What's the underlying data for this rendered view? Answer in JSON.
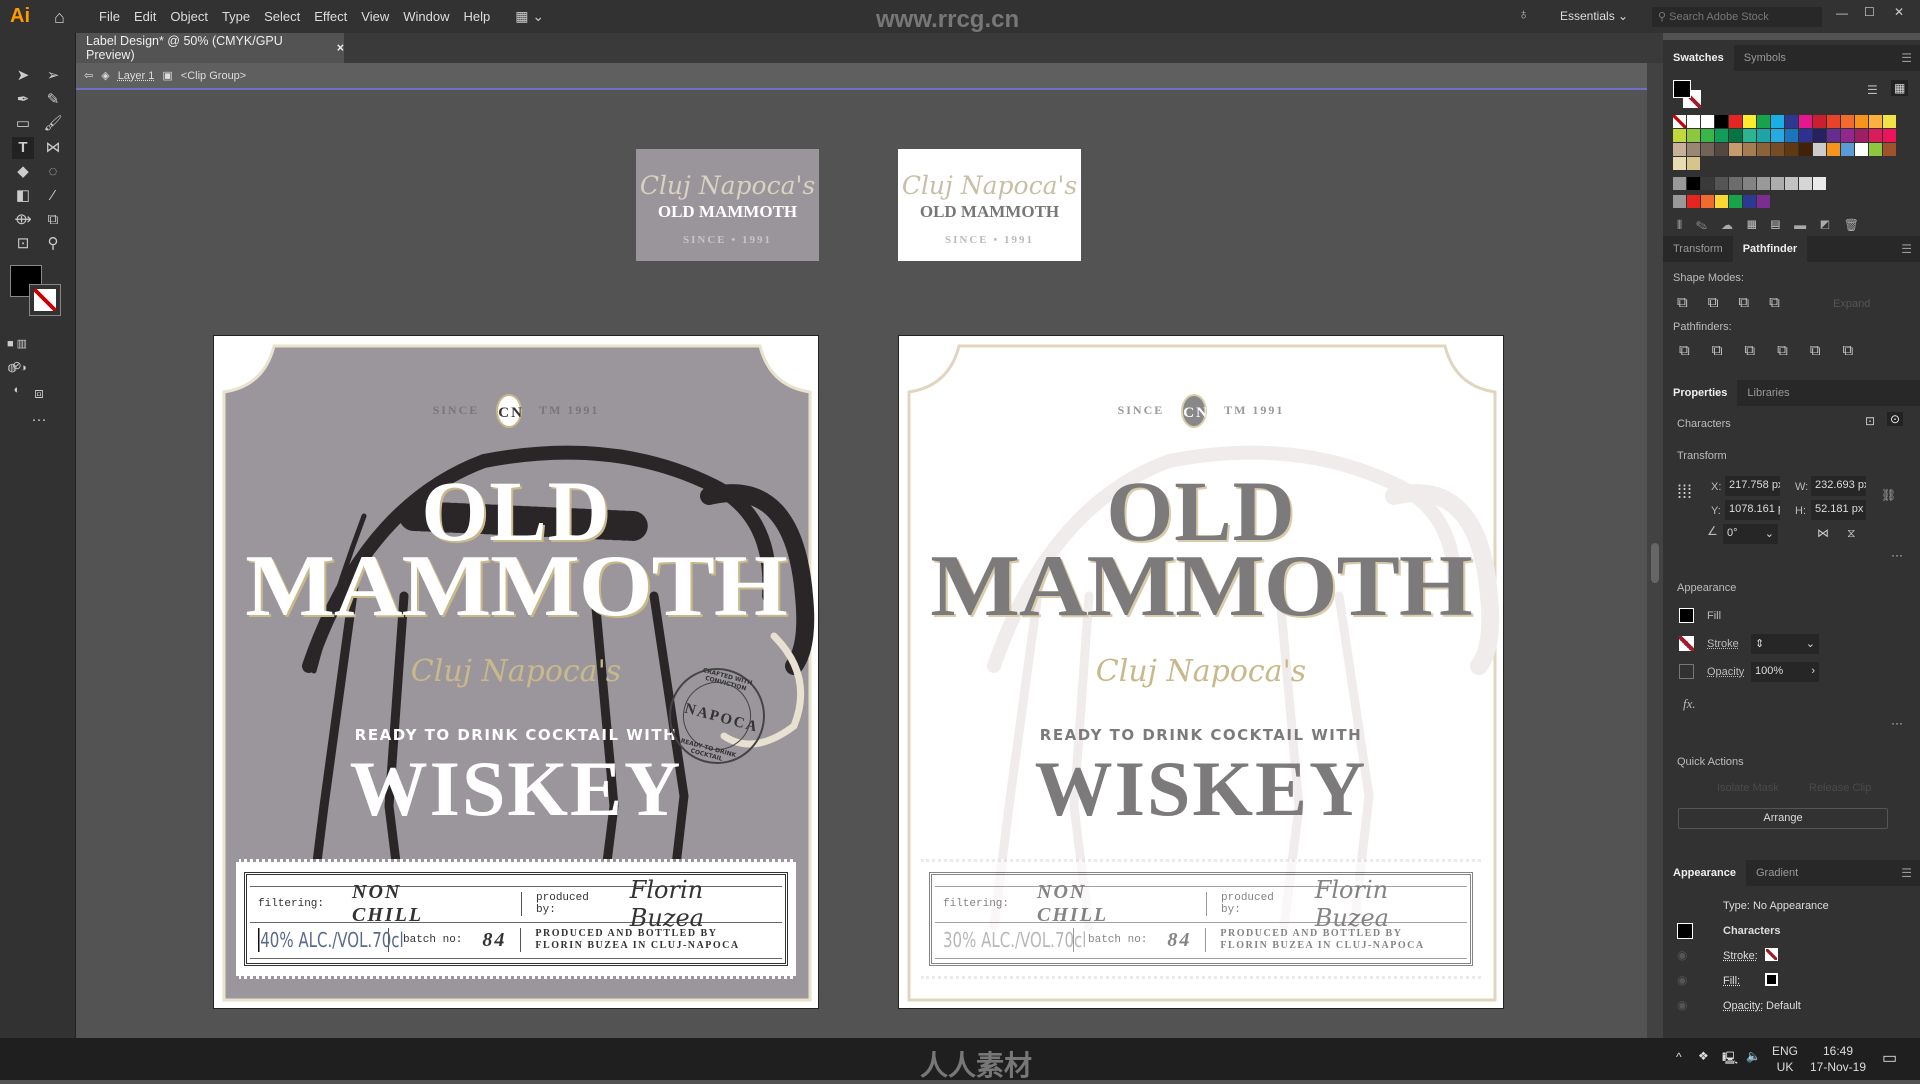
{
  "app": {
    "logo": "Ai",
    "menu": [
      "File",
      "Edit",
      "Object",
      "Type",
      "Select",
      "Effect",
      "View",
      "Window",
      "Help"
    ],
    "workspace": "Essentials",
    "search_placeholder": "Search Adobe Stock",
    "watermark": "www.rrcg.cn"
  },
  "document": {
    "tab_title": "Label Design* @ 50% (CMYK/GPU Preview)",
    "close": "×",
    "breadcrumb": {
      "layer": "Layer 1",
      "group": "<Clip Group>"
    }
  },
  "colors": {
    "accent": "#ff9a00",
    "label_grey": "#9b969c",
    "gold": "#c9b98a",
    "selection": "#6a72c8"
  },
  "artboards": {
    "small_labels": [
      {
        "variant": "grey",
        "script": "Cluj Napoca's",
        "name": "OLD MAMMOTH",
        "since": "SINCE • 1991"
      },
      {
        "variant": "white",
        "script": "Cluj Napoca's",
        "name": "OLD MAMMOTH",
        "since": "SINCE • 1991"
      }
    ],
    "big_labels": [
      {
        "variant": "grey",
        "since": "SINCE",
        "monogram": "CN",
        "year": "TM 1991",
        "line1": "OLD",
        "line2": "MAMMOTH",
        "script": "Cluj Napoca's",
        "tagline": "READY TO DRINK COCKTAIL WITH",
        "product": "WISKEY",
        "stamp": {
          "top": "CRAFTED WITH CONVICTION",
          "center": "NAPOCA",
          "bottom": "READY TO DRINK COCKTAIL"
        },
        "info": {
          "filtering_label": "filtering:",
          "filtering": "NON CHILL",
          "produced_label": "produced by:",
          "signature": "Florin Buzea",
          "alc": "40% ALC./VOL.70cl",
          "batch_label": "batch no:",
          "batch": "84",
          "produced_line1": "PRODUCED AND BOTTLED BY",
          "produced_line2": "FLORIN BUZEA IN CLUJ-NAPOCA"
        }
      },
      {
        "variant": "white",
        "since": "SINCE",
        "monogram": "CN",
        "year": "TM 1991",
        "line1": "OLD",
        "line2": "MAMMOTH",
        "script": "Cluj Napoca's",
        "tagline": "READY TO DRINK COCKTAIL WITH",
        "product": "WISKEY",
        "info": {
          "filtering_label": "filtering:",
          "filtering": "NON CHILL",
          "produced_label": "produced by:",
          "signature": "Florin Buzea",
          "alc": "30% ALC./VOL.70cl",
          "batch_label": "batch no:",
          "batch": "84",
          "produced_line1": "PRODUCED AND BOTTLED BY",
          "produced_line2": "FLORIN BUZEA IN CLUJ-NAPOCA"
        }
      }
    ]
  },
  "panels": {
    "swatches": {
      "tabs": [
        "Swatches",
        "Symbols"
      ],
      "rows": [
        [
          "#ffffff",
          "#000000",
          "#e52521",
          "#fdec2d",
          "#16a34a",
          "#19aee6",
          "#2b3990",
          "#e5178d",
          "#c8202f",
          "#e8432a",
          "#f26b2e",
          "#f7941d",
          "#fbb040",
          "#f0e446"
        ],
        [
          "#c2d93e",
          "#8dc63f",
          "#39b54a",
          "#0f9d58",
          "#087443",
          "#2bb58f",
          "#1fa4a6",
          "#27aae1",
          "#1c75bc",
          "#2e3192",
          "#262262",
          "#662d91",
          "#92278f",
          "#9e1f63",
          "#da1c5c",
          "#ed145b"
        ],
        [
          "#c7b299",
          "#998675",
          "#736357",
          "#534741",
          "#c69c6d",
          "#a67c52",
          "#8c6239",
          "#754c24",
          "#603913",
          "#42210b",
          "#cccccc",
          "#f7941d",
          "#5b9bd5",
          "#ffffff",
          "#8dc63f",
          "#a0522d"
        ]
      ],
      "greys": [
        "#000000",
        "#3a3a3a",
        "#555555",
        "#6d6d6d",
        "#838383",
        "#999999",
        "#adadad",
        "#c2c2c2",
        "#d6d6d6",
        "#eaeaea"
      ],
      "brights": [
        "#e52521",
        "#f26b2e",
        "#fdd835",
        "#16a34a",
        "#2b3990",
        "#7b2d91"
      ]
    },
    "pathfinder": {
      "tabs": [
        "Transform",
        "Pathfinder"
      ],
      "shape_modes": "Shape Modes:",
      "pathfinders": "Pathfinders:",
      "expand": "Expand"
    },
    "properties": {
      "tabs": [
        "Properties",
        "Libraries"
      ],
      "selection": "Characters",
      "transform": {
        "title": "Transform",
        "x_label": "X:",
        "x": "217.758 px",
        "y_label": "Y:",
        "y": "1078.161 p",
        "w_label": "W:",
        "w": "232.693 px",
        "h_label": "H:",
        "h": "52.181 px",
        "angle": "0°"
      },
      "appearance": {
        "title": "Appearance",
        "fill": "Fill",
        "stroke": "Stroke",
        "opacity": "Opacity",
        "opacity_value": "100%",
        "fx": "fx."
      },
      "quick_actions": {
        "title": "Quick Actions",
        "isolate": "Isolate Mask",
        "release": "Release Clip",
        "arrange": "Arrange"
      }
    },
    "appearance": {
      "tabs": [
        "Appearance",
        "Gradient"
      ],
      "type": "Type: No Appearance",
      "characters": "Characters",
      "stroke": "Stroke:",
      "fill": "Fill:",
      "opacity": "Opacity:",
      "opacity_value": "Default"
    }
  },
  "taskbar": {
    "lang1": "ENG",
    "lang2": "UK",
    "time": "16:49",
    "date": "17-Nov-19",
    "brand": "人人素材"
  }
}
